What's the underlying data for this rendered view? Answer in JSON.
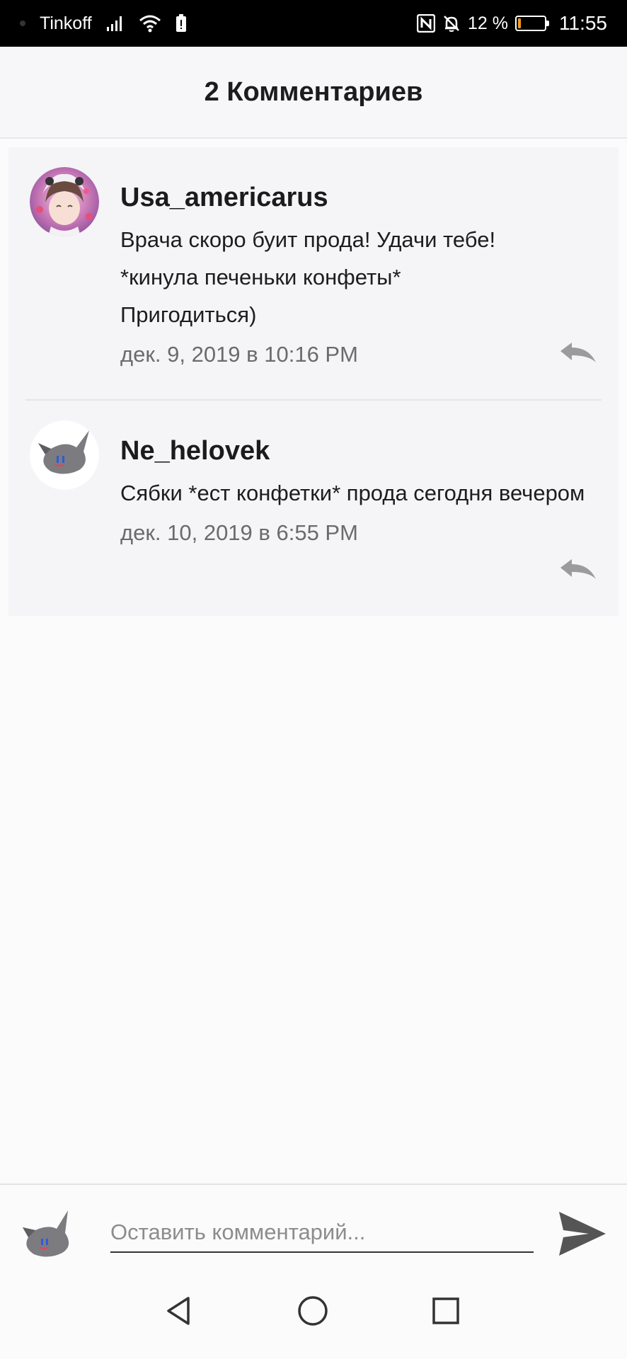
{
  "status_bar": {
    "carrier": "Tinkoff",
    "battery_percent": "12 %",
    "battery_level": 0.12,
    "time": "11:55"
  },
  "header": {
    "title": "2 Комментариев"
  },
  "comments": [
    {
      "author": "Usa_americarus",
      "text": "Врача скоро буит прода! Удачи тебе! *кинула печеньки конфеты* Пригодиться)",
      "date": "дек. 9, 2019 в 10:16 PM"
    },
    {
      "author": "Ne_helovek",
      "text": "Сябки *ест конфетки* прода сегодня вечером",
      "date": "дек. 10, 2019 в 6:55 PM"
    }
  ],
  "composer": {
    "placeholder": "Оставить комментарий..."
  },
  "colors": {
    "header_bg": "#f7f6f8",
    "comment_bg": "#f5f4f7",
    "date_text": "#6b6b6b",
    "icon_gray": "#9b9b9b",
    "battery_fill": "#f29b1d"
  },
  "icons": {
    "signal": "signal-icon",
    "wifi": "wifi-icon",
    "nfc": "nfc-icon",
    "mute": "bell-off-icon",
    "reply": "reply-icon",
    "send": "send-icon",
    "back": "nav-back-icon",
    "home": "nav-home-icon",
    "recent": "nav-recent-icon"
  }
}
